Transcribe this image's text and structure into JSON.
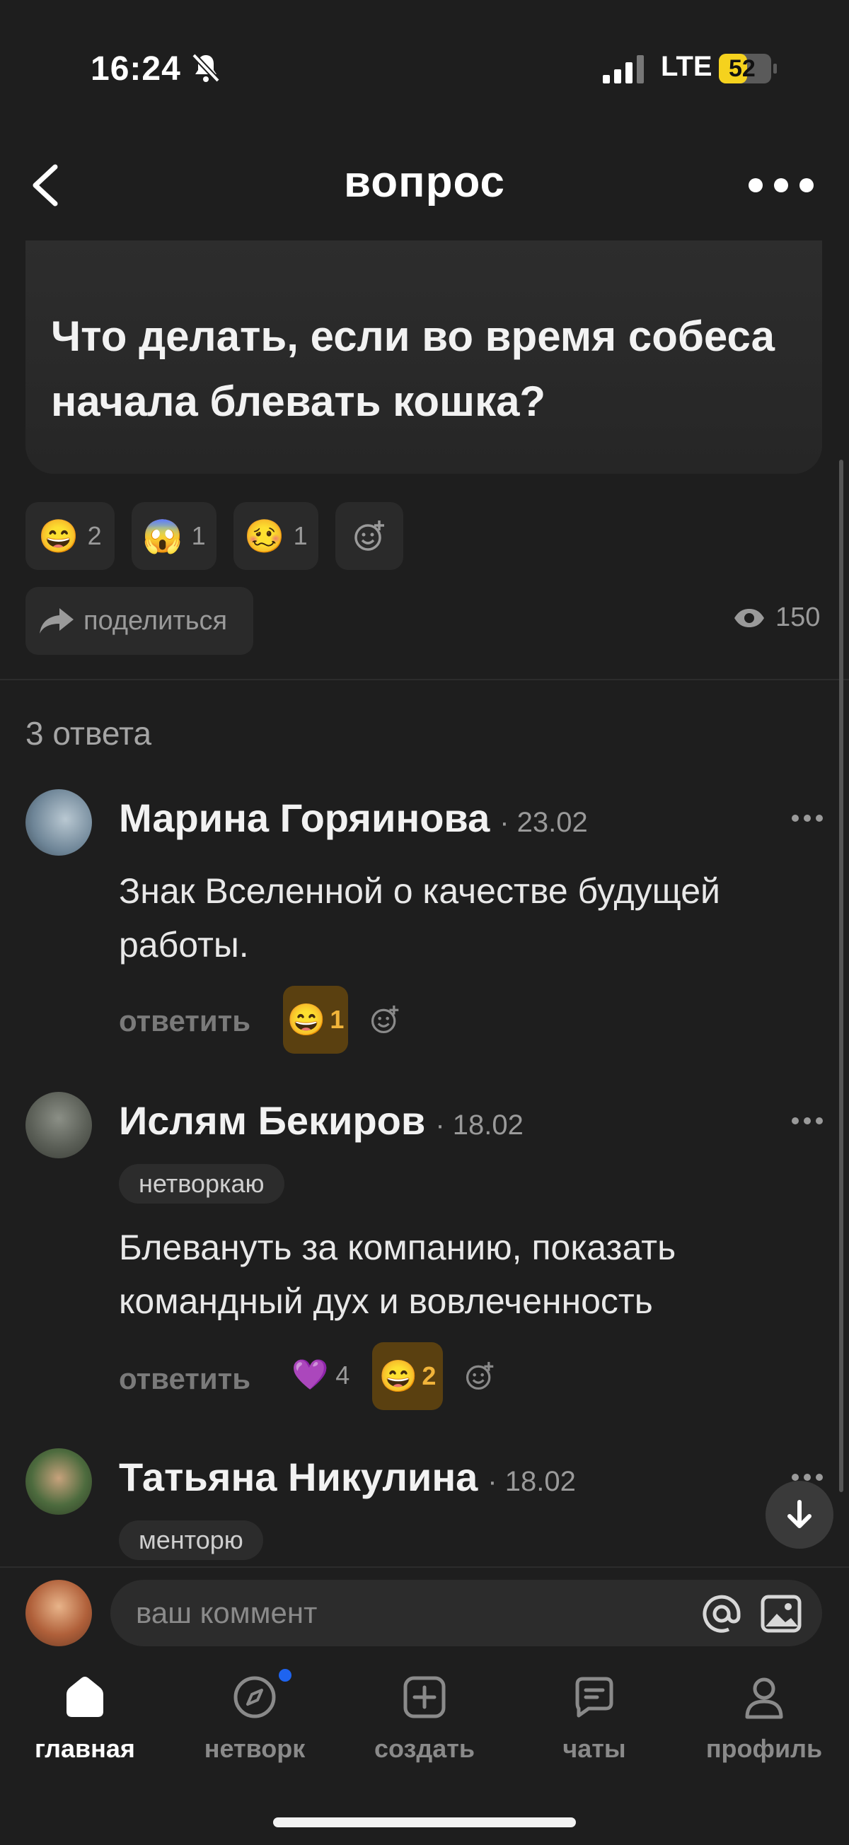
{
  "status_bar": {
    "time": "16:24",
    "network": "LTE",
    "battery": "52"
  },
  "header": {
    "title": "вопрос"
  },
  "question": {
    "text": "Что делать, если во время собеса начала блевать кошка?"
  },
  "reactions": [
    {
      "emoji": "😄",
      "count": "2"
    },
    {
      "emoji": "😱",
      "count": "1"
    },
    {
      "emoji": "🥴",
      "count": "1"
    }
  ],
  "share": {
    "label": "поделиться"
  },
  "views": {
    "count": "150"
  },
  "answers": {
    "count_label": "3 ответа"
  },
  "comments": [
    {
      "name": "Марина Горяинова",
      "date": "· 23.02",
      "text": "Знак Вселенной о качестве будущей работы.",
      "reply": "ответить",
      "chip_emoji": "😄",
      "chip_count": "1"
    },
    {
      "name": "Ислям Бекиров",
      "date": "· 18.02",
      "tag": "нетворкаю",
      "text": "Блевануть за компанию, показать командный дух и вовлеченность",
      "reply": "ответить",
      "plain_emoji": "💜",
      "plain_count": "4",
      "chip_emoji": "😄",
      "chip_count": "2"
    },
    {
      "name": "Татьяна Никулина",
      "date": "· 18.02",
      "tag": "менторю"
    }
  ],
  "composer": {
    "placeholder": "ваш коммент"
  },
  "tabbar": [
    {
      "label": "главная"
    },
    {
      "label": "нетворк"
    },
    {
      "label": "создать"
    },
    {
      "label": "чаты"
    },
    {
      "label": "профиль"
    }
  ],
  "colors": {
    "background": "#1e1e1e",
    "chip_active": "#5a4010",
    "chip_text": "#f1b43a",
    "battery": "#f5d21e"
  }
}
